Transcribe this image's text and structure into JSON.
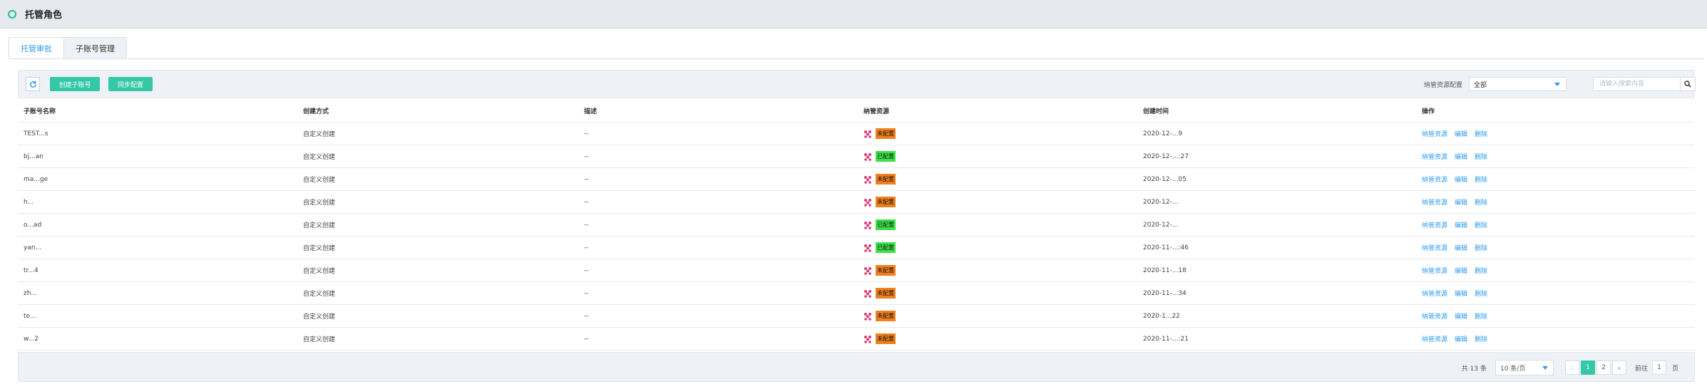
{
  "header": {
    "title": "托管角色"
  },
  "tabs": [
    {
      "label": "托管审批",
      "active": false
    },
    {
      "label": "子账号管理",
      "active": true
    }
  ],
  "toolbar": {
    "refresh_icon": "refresh-icon",
    "create_label": "创建子账号",
    "sync_label": "同步配置",
    "filter_label": "纳管资源配置",
    "filter_value": "全部",
    "search_placeholder": "请输入搜索内容",
    "search_icon": "search-icon"
  },
  "table": {
    "columns": [
      "子账号名称",
      "创建方式",
      "描述",
      "纳管资源",
      "创建时间",
      "操作"
    ],
    "rows": [
      {
        "name": "TEST...s",
        "method": "自定义创建",
        "desc": "--",
        "status": "未配置",
        "status_color": "#f07f1d",
        "time": "2020-12-...9"
      },
      {
        "name": "bj...an",
        "method": "自定义创建",
        "desc": "--",
        "status": "已配置",
        "status_color": "#3ee04a",
        "time": "2020-12-...:27"
      },
      {
        "name": "ma...ge",
        "method": "自定义创建",
        "desc": "--",
        "status": "未配置",
        "status_color": "#f07f1d",
        "time": "2020-12-...05"
      },
      {
        "name": "h...",
        "method": "自定义创建",
        "desc": "--",
        "status": "未配置",
        "status_color": "#f07f1d",
        "time": "2020-12-..."
      },
      {
        "name": "o...ad",
        "method": "自定义创建",
        "desc": "--",
        "status": "已配置",
        "status_color": "#3ee04a",
        "time": "2020-12-..."
      },
      {
        "name": "yan...",
        "method": "自定义创建",
        "desc": "--",
        "status": "已配置",
        "status_color": "#3ee04a",
        "time": "2020-11-...:46"
      },
      {
        "name": "tr...4",
        "method": "自定义创建",
        "desc": "--",
        "status": "未配置",
        "status_color": "#f07f1d",
        "time": "2020-11-...18"
      },
      {
        "name": "zh...",
        "method": "自定义创建",
        "desc": "--",
        "status": "未配置",
        "status_color": "#f07f1d",
        "time": "2020-11-...34"
      },
      {
        "name": "te...",
        "method": "自定义创建",
        "desc": "--",
        "status": "未配置",
        "status_color": "#f07f1d",
        "time": "2020-1...22"
      },
      {
        "name": "w...2",
        "method": "自定义创建",
        "desc": "--",
        "status": "未配置",
        "status_color": "#f07f1d",
        "time": "2020-11-...:21"
      }
    ],
    "actions": [
      "纳管资源",
      "编辑",
      "删除"
    ]
  },
  "pagination": {
    "total": "共 13 条",
    "page_size": "10 条/页",
    "pages": [
      "1",
      "2"
    ],
    "current_page": "1",
    "goto_label": "前往",
    "goto_value": "1",
    "page_suffix": "页"
  },
  "colors": {
    "accent": "#34c8a6",
    "link": "#2d9bf0",
    "unconfigured": "#f07f1d",
    "configured": "#3ee04a"
  }
}
